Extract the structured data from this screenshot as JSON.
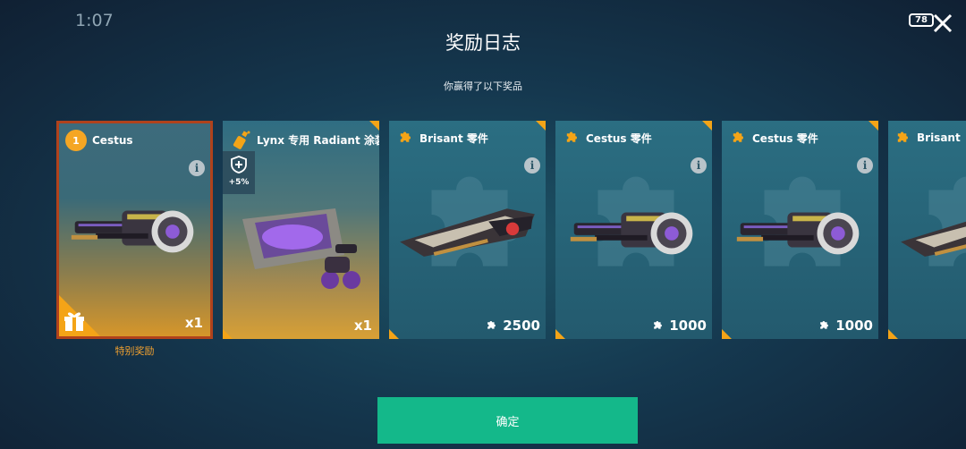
{
  "status_bar": {
    "time": "1:07",
    "battery": "78"
  },
  "header": {
    "title": "奖励日志",
    "subtitle": "你赢得了以下奖品"
  },
  "cards": [
    {
      "name": "Cestus",
      "rank": "1",
      "quantity": "x1",
      "type": "weapon-special"
    },
    {
      "name": "Lynx 专用 Radiant 涂装",
      "quantity": "x1",
      "bonus": "+5%",
      "type": "skin"
    },
    {
      "name": "Brisant 零件",
      "quantity": "2500",
      "type": "parts"
    },
    {
      "name": "Cestus 零件",
      "quantity": "1000",
      "type": "parts"
    },
    {
      "name": "Cestus 零件",
      "quantity": "1000",
      "type": "parts"
    },
    {
      "name": "Brisant",
      "type": "parts"
    }
  ],
  "special_reward_label": "特别奖励",
  "confirm_label": "确定",
  "colors": {
    "accent": "#f4a417",
    "confirm": "#14b88a",
    "special": "#f0a030",
    "rare_border": "#b0421c"
  },
  "icons": [
    "close-icon",
    "info-icon",
    "puzzle-icon",
    "shield-icon",
    "gift-icon",
    "spray-can-icon"
  ]
}
